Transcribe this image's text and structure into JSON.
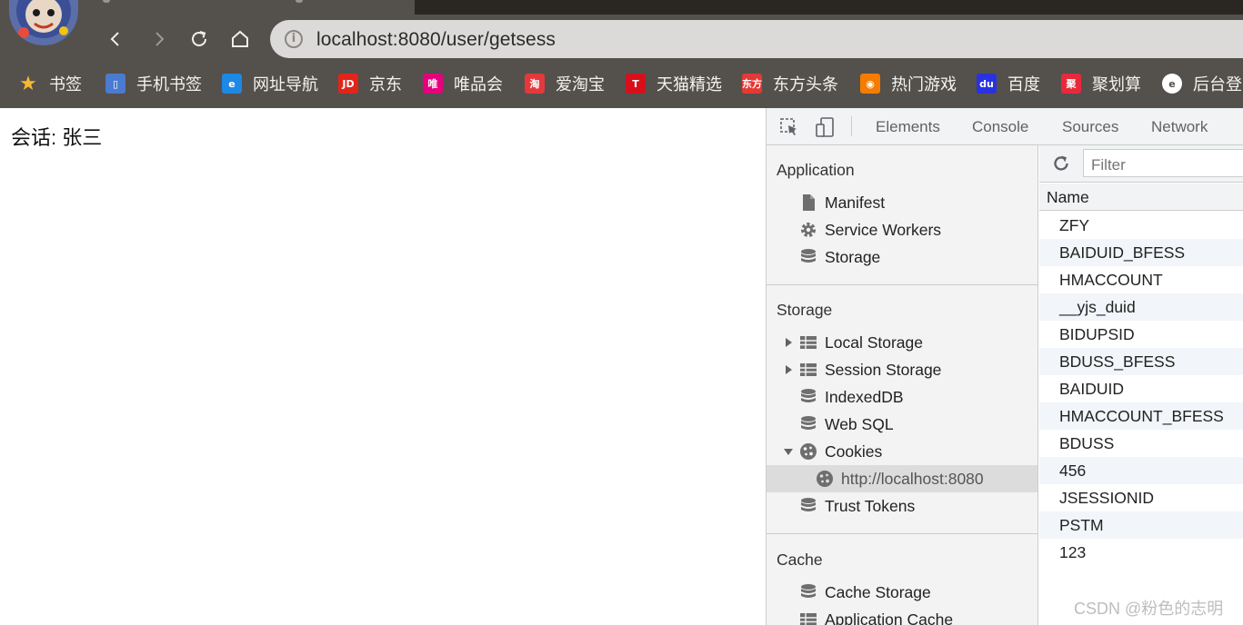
{
  "browser": {
    "url": "localhost:8080/user/getsess",
    "bookmarks": [
      {
        "label": "书签",
        "icon": "star-icon",
        "color": "#f5b82e",
        "glyph": "★"
      },
      {
        "label": "手机书签",
        "icon": "phone-bookmark-icon",
        "color": "#4a7bd0",
        "glyph": "▯"
      },
      {
        "label": "网址导航",
        "icon": "e-browser-icon",
        "color": "#1e88e5",
        "glyph": "e"
      },
      {
        "label": "京东",
        "icon": "jd-icon",
        "color": "#e1251b",
        "glyph": "JD"
      },
      {
        "label": "唯品会",
        "icon": "vip-icon",
        "color": "#e6007e",
        "glyph": "唯"
      },
      {
        "label": "爱淘宝",
        "icon": "taobao-icon",
        "color": "#e4393c",
        "glyph": "淘"
      },
      {
        "label": "天猫精选",
        "icon": "tmall-icon",
        "color": "#d70f1b",
        "glyph": "T"
      },
      {
        "label": "东方头条",
        "icon": "dftt-icon",
        "color": "#e53935",
        "glyph": "东方"
      },
      {
        "label": "热门游戏",
        "icon": "game-icon",
        "color": "#f57c00",
        "glyph": "◉"
      },
      {
        "label": "百度",
        "icon": "baidu-icon",
        "color": "#2932e1",
        "glyph": "du"
      },
      {
        "label": "聚划算",
        "icon": "juhuasuan-icon",
        "color": "#e8293b",
        "glyph": "聚"
      },
      {
        "label": "后台登",
        "icon": "e-icon",
        "color": "#ffffff",
        "glyph": "e"
      }
    ]
  },
  "page": {
    "text": "会话: 张三"
  },
  "devtools": {
    "tabs": [
      "Elements",
      "Console",
      "Sources",
      "Network"
    ],
    "sections": {
      "application": {
        "title": "Application",
        "items": [
          "Manifest",
          "Service Workers",
          "Storage"
        ]
      },
      "storage": {
        "title": "Storage",
        "items": [
          "Local Storage",
          "Session Storage",
          "IndexedDB",
          "Web SQL",
          "Cookies",
          "http://localhost:8080",
          "Trust Tokens"
        ]
      },
      "cache": {
        "title": "Cache",
        "items": [
          "Cache Storage",
          "Application Cache"
        ]
      }
    },
    "filter_placeholder": "Filter",
    "name_header": "Name",
    "cookie_names": [
      "ZFY",
      "BAIDUID_BFESS",
      "HMACCOUNT",
      "__yjs_duid",
      "BIDUPSID",
      "BDUSS_BFESS",
      "BAIDUID",
      "HMACCOUNT_BFESS",
      "BDUSS",
      "456",
      "JSESSIONID",
      "PSTM",
      "123"
    ]
  },
  "watermark": "CSDN @粉色的志明"
}
